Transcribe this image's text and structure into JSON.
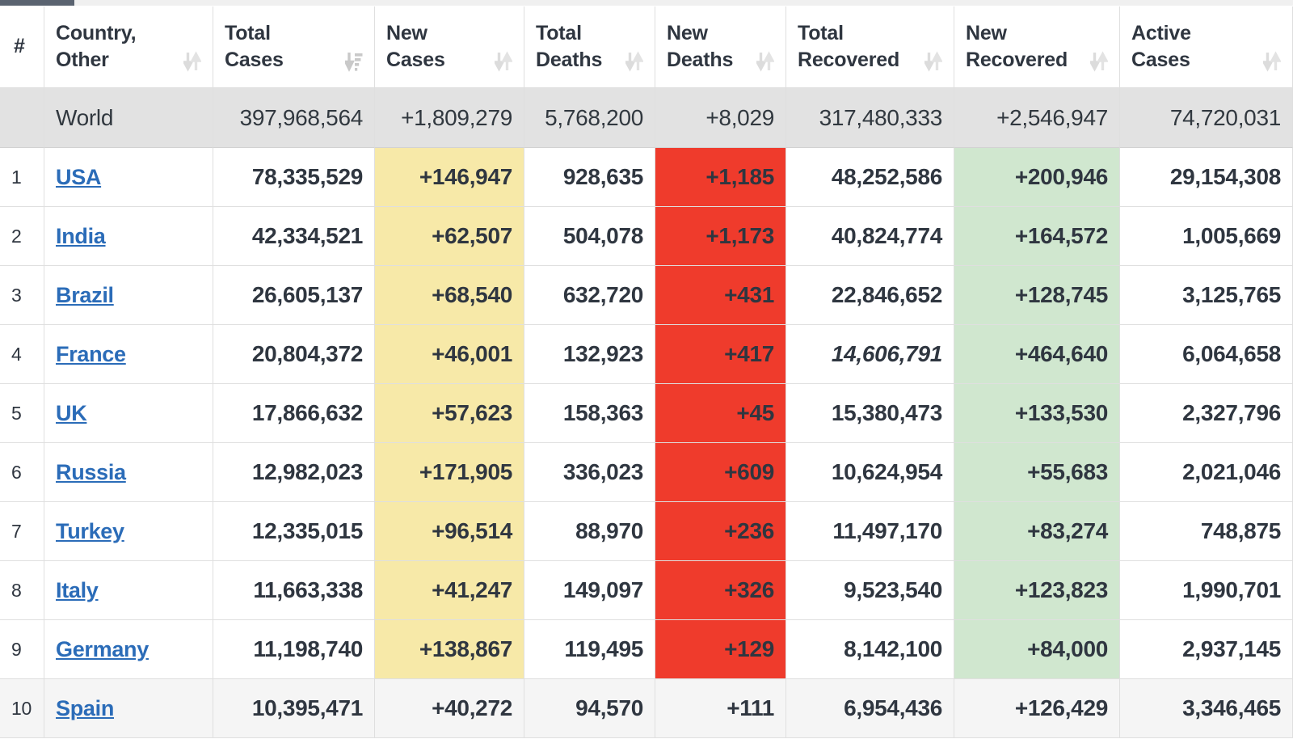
{
  "scrollbar": {
    "name": "horizontal-scrollbar"
  },
  "table": {
    "columns": [
      {
        "id": "rank",
        "label": "#",
        "label_line1": "",
        "label_line2": "#",
        "sort_icon": "none"
      },
      {
        "id": "country",
        "label": "Country, Other",
        "label_line1": "Country,",
        "label_line2": "Other",
        "sort_icon": "sort-both-icon"
      },
      {
        "id": "total_cases",
        "label": "Total Cases",
        "label_line1": "Total",
        "label_line2": "Cases",
        "sort_icon": "sort-amount-down-icon"
      },
      {
        "id": "new_cases",
        "label": "New Cases",
        "label_line1": "New",
        "label_line2": "Cases",
        "sort_icon": "sort-both-icon"
      },
      {
        "id": "total_deaths",
        "label": "Total Deaths",
        "label_line1": "Total",
        "label_line2": "Deaths",
        "sort_icon": "sort-both-icon"
      },
      {
        "id": "new_deaths",
        "label": "New Deaths",
        "label_line1": "New",
        "label_line2": "Deaths",
        "sort_icon": "sort-both-icon"
      },
      {
        "id": "total_rec",
        "label": "Total Recovered",
        "label_line1": "Total",
        "label_line2": "Recovered",
        "sort_icon": "sort-both-icon"
      },
      {
        "id": "new_rec",
        "label": "New Recovered",
        "label_line1": "New",
        "label_line2": "Recovered",
        "sort_icon": "sort-both-icon"
      },
      {
        "id": "active",
        "label": "Active Cases",
        "label_line1": "Active",
        "label_line2": "Cases",
        "sort_icon": "sort-both-icon"
      }
    ],
    "world_row": {
      "rank": "",
      "country": "World",
      "total_cases": "397,968,564",
      "new_cases": "+1,809,279",
      "total_deaths": "5,768,200",
      "new_deaths": "+8,029",
      "total_recovered": "317,480,333",
      "new_recovered": "+2,546,947",
      "active_cases": "74,720,031"
    },
    "rows": [
      {
        "rank": "1",
        "country": "USA",
        "total_cases": "78,335,529",
        "new_cases": "+146,947",
        "total_deaths": "928,635",
        "new_deaths": "+1,185",
        "total_recovered": "48,252,586",
        "total_recovered_muted": false,
        "new_recovered": "+200,946",
        "active_cases": "29,154,308",
        "shaded": false
      },
      {
        "rank": "2",
        "country": "India",
        "total_cases": "42,334,521",
        "new_cases": "+62,507",
        "total_deaths": "504,078",
        "new_deaths": "+1,173",
        "total_recovered": "40,824,774",
        "total_recovered_muted": false,
        "new_recovered": "+164,572",
        "active_cases": "1,005,669",
        "shaded": false
      },
      {
        "rank": "3",
        "country": "Brazil",
        "total_cases": "26,605,137",
        "new_cases": "+68,540",
        "total_deaths": "632,720",
        "new_deaths": "+431",
        "total_recovered": "22,846,652",
        "total_recovered_muted": false,
        "new_recovered": "+128,745",
        "active_cases": "3,125,765",
        "shaded": false
      },
      {
        "rank": "4",
        "country": "France",
        "total_cases": "20,804,372",
        "new_cases": "+46,001",
        "total_deaths": "132,923",
        "new_deaths": "+417",
        "total_recovered": "14,606,791",
        "total_recovered_muted": true,
        "new_recovered": "+464,640",
        "active_cases": "6,064,658",
        "shaded": false
      },
      {
        "rank": "5",
        "country": "UK",
        "total_cases": "17,866,632",
        "new_cases": "+57,623",
        "total_deaths": "158,363",
        "new_deaths": "+45",
        "total_recovered": "15,380,473",
        "total_recovered_muted": false,
        "new_recovered": "+133,530",
        "active_cases": "2,327,796",
        "shaded": false
      },
      {
        "rank": "6",
        "country": "Russia",
        "total_cases": "12,982,023",
        "new_cases": "+171,905",
        "total_deaths": "336,023",
        "new_deaths": "+609",
        "total_recovered": "10,624,954",
        "total_recovered_muted": false,
        "new_recovered": "+55,683",
        "active_cases": "2,021,046",
        "shaded": false
      },
      {
        "rank": "7",
        "country": "Turkey",
        "total_cases": "12,335,015",
        "new_cases": "+96,514",
        "total_deaths": "88,970",
        "new_deaths": "+236",
        "total_recovered": "11,497,170",
        "total_recovered_muted": false,
        "new_recovered": "+83,274",
        "active_cases": "748,875",
        "shaded": false
      },
      {
        "rank": "8",
        "country": "Italy",
        "total_cases": "11,663,338",
        "new_cases": "+41,247",
        "total_deaths": "149,097",
        "new_deaths": "+326",
        "total_recovered": "9,523,540",
        "total_recovered_muted": false,
        "new_recovered": "+123,823",
        "active_cases": "1,990,701",
        "shaded": false
      },
      {
        "rank": "9",
        "country": "Germany",
        "total_cases": "11,198,740",
        "new_cases": "+138,867",
        "total_deaths": "119,495",
        "new_deaths": "+129",
        "total_recovered": "8,142,100",
        "total_recovered_muted": false,
        "new_recovered": "+84,000",
        "active_cases": "2,937,145",
        "shaded": false
      },
      {
        "rank": "10",
        "country": "Spain",
        "total_cases": "10,395,471",
        "new_cases": "+40,272",
        "total_deaths": "94,570",
        "new_deaths": "+111",
        "total_recovered": "6,954,436",
        "total_recovered_muted": false,
        "new_recovered": "+126,429",
        "active_cases": "3,346,465",
        "shaded": true
      }
    ]
  },
  "colors": {
    "new_cases_bg": "#f7e9a8",
    "new_deaths_bg": "#ef3b2c",
    "new_recovered_bg": "#d0e7cf",
    "world_row_bg": "#e2e2e2",
    "link": "#2b6cb8",
    "text": "#2b3440",
    "muted": "#8d8d8d",
    "scrollbar_thumb": "#5a6370"
  }
}
